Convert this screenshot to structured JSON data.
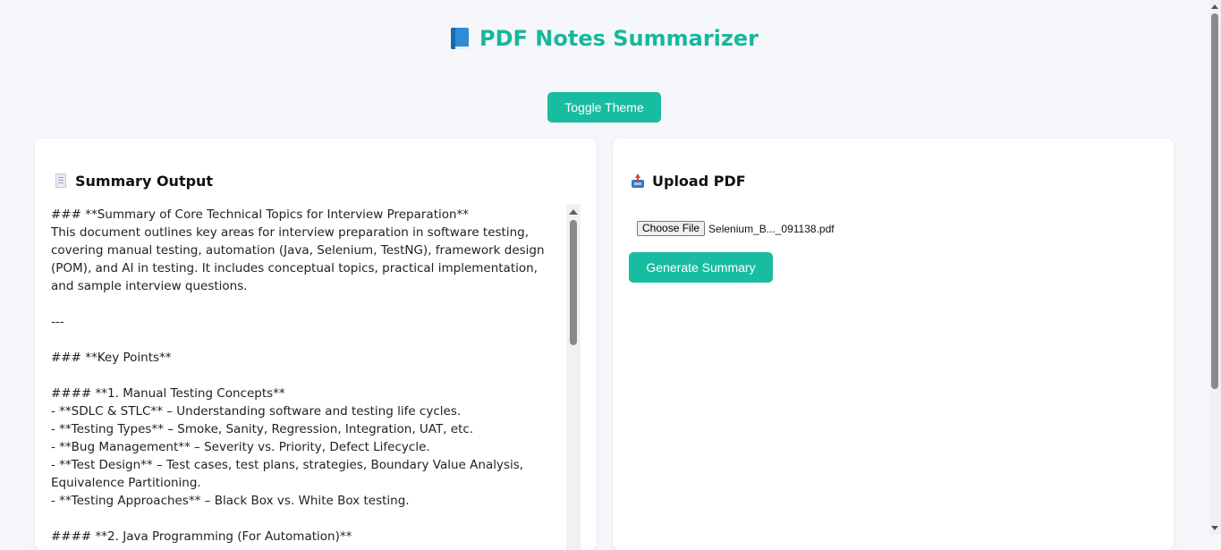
{
  "header": {
    "title": "PDF Notes Summarizer",
    "title_icon": "blue-book-icon",
    "accent_color": "#17b79b"
  },
  "toolbar": {
    "toggle_theme_label": "Toggle Theme"
  },
  "summary_panel": {
    "heading": "Summary Output",
    "heading_icon": "page-icon",
    "lines": [
      "### **Summary of Core Technical Topics for Interview Preparation**",
      "This document outlines key areas for interview preparation in software testing, covering manual testing, automation (Java, Selenium, TestNG), framework design (POM), and AI in testing. It includes conceptual topics, practical implementation, and sample interview questions.",
      "",
      "---",
      "",
      "### **Key Points**",
      "",
      "#### **1. Manual Testing Concepts**",
      "- **SDLC & STLC** – Understanding software and testing life cycles.",
      "- **Testing Types** – Smoke, Sanity, Regression, Integration, UAT, etc.",
      "- **Bug Management** – Severity vs. Priority, Defect Lifecycle.",
      "- **Test Design** – Test cases, test plans, strategies, Boundary Value Analysis, Equivalence Partitioning.",
      "- **Testing Approaches** – Black Box vs. White Box testing.",
      "",
      "#### **2. Java Programming (For Automation)**"
    ]
  },
  "upload_panel": {
    "heading": "Upload PDF",
    "heading_icon": "outbox-tray-icon",
    "choose_file_label": "Choose File",
    "selected_file_name": "Selenium_B..._091138.pdf",
    "generate_label": "Generate Summary"
  }
}
